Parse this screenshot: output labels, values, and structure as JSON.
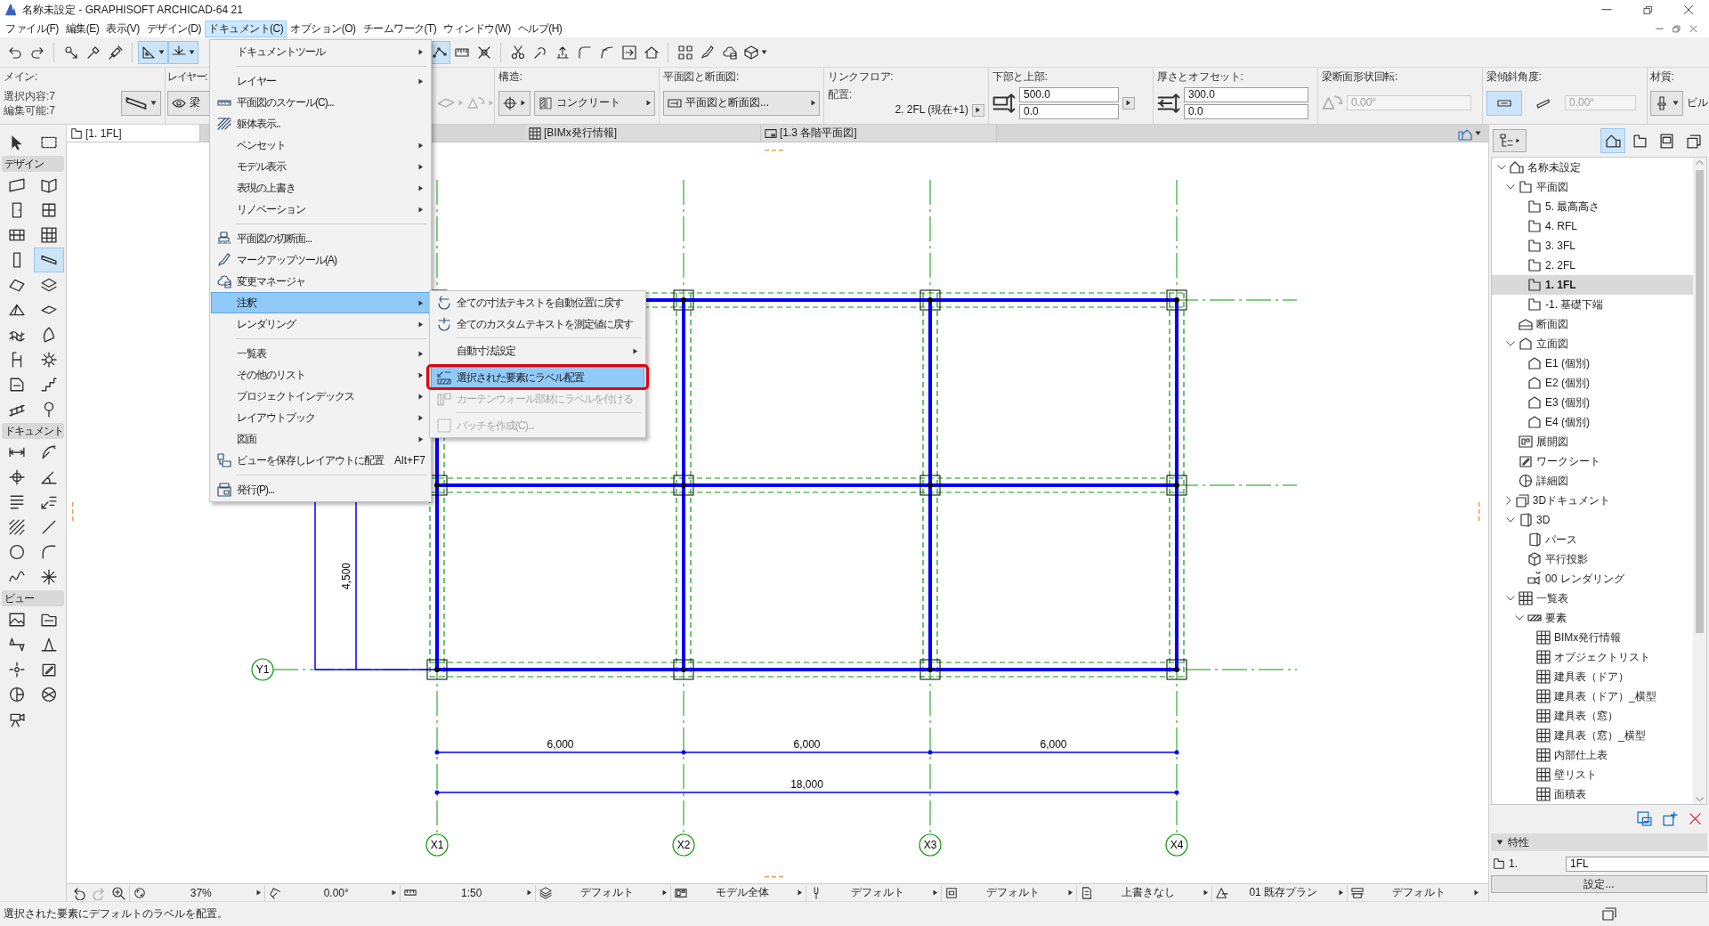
{
  "window": {
    "title": "名称未設定 - GRAPHISOFT ARCHICAD-64 21"
  },
  "menu_bar": [
    {
      "label": "ファイル(F)",
      "selected": false
    },
    {
      "label": "編集(E)",
      "selected": false
    },
    {
      "label": "表示(V)",
      "selected": false
    },
    {
      "label": "デザイン(D)",
      "selected": false
    },
    {
      "label": "ドキュメント(C)",
      "selected": true
    },
    {
      "label": "オプション(O)",
      "selected": false
    },
    {
      "label": "チームワーク(T)",
      "selected": false
    },
    {
      "label": "ウィンドウ(W)",
      "selected": false
    },
    {
      "label": "ヘルプ(H)",
      "selected": false
    }
  ],
  "toolbar": {
    "groups": [
      [
        {
          "selected": false
        },
        {
          "selected": false
        }
      ],
      [
        {
          "selected": false
        },
        {
          "selected": false
        },
        {
          "selected": false
        }
      ],
      [
        {
          "selected": true
        },
        {
          "selected": true
        }
      ],
      [
        {
          "selected": true
        },
        {
          "selected": false
        },
        {
          "selected": false
        }
      ],
      [
        {
          "selected": false
        },
        {
          "selected": false
        },
        {
          "selected": false
        },
        {
          "selected": false
        },
        {
          "selected": false
        },
        {
          "selected": false
        },
        {
          "selected": false
        }
      ],
      [
        {
          "selected": false
        },
        {
          "selected": false
        },
        {
          "selected": false
        },
        {
          "selected": false
        }
      ]
    ]
  },
  "info_box": {
    "main": {
      "label": "メイン:",
      "selection": "選択内容:7",
      "editable": "編集可能:7"
    },
    "layer": {
      "label": "レイヤー:",
      "value": "梁"
    },
    "structure": {
      "label": "構造:",
      "material": "コンクリート"
    },
    "plan_and_section": {
      "label": "平面図と断面図:",
      "value": "平面図と断面図..."
    },
    "link_floor": {
      "label": "リンクフロア:",
      "placement": "配置:",
      "value": "2. 2FL (現在+1)"
    },
    "bottom_top": {
      "label": "下部と上部:",
      "fields": [
        "500.0",
        "0.0"
      ]
    },
    "thickness_offset": {
      "label": "厚さとオフセット:",
      "fields": [
        "300.0",
        "0.0"
      ]
    },
    "profile_rotation": {
      "label": "梁断面形状回転:",
      "value": "0.00°",
      "disabled": true
    },
    "slant_angle": {
      "label": "梁傾斜角度:",
      "options": [
        {
          "selected": true
        },
        {
          "selected": false
        }
      ],
      "value": "0.00°",
      "disabled": true
    },
    "material": {
      "label": "材質:",
      "value": "ビル"
    }
  },
  "toolbox": {
    "top_tools": [
      {
        "selected": false
      },
      {
        "selected": false
      }
    ],
    "sections": [
      {
        "title": "デザイン",
        "tools": [
          {
            "selected": false
          },
          {
            "selected": false
          },
          {
            "selected": false
          },
          {
            "selected": false
          },
          {
            "selected": false
          },
          {
            "selected": false
          },
          {
            "selected": false
          },
          {
            "selected": true
          },
          {
            "selected": false
          },
          {
            "selected": false
          },
          {
            "selected": false
          },
          {
            "selected": false
          },
          {
            "selected": false
          },
          {
            "selected": false
          },
          {
            "selected": false
          },
          {
            "selected": false
          },
          {
            "selected": false
          },
          {
            "selected": false
          },
          {
            "selected": false
          },
          {
            "selected": false
          }
        ]
      },
      {
        "title": "ドキュメント",
        "tools": [
          {
            "selected": false
          },
          {
            "selected": false
          },
          {
            "selected": false
          },
          {
            "selected": false
          },
          {
            "selected": false
          },
          {
            "selected": false
          },
          {
            "selected": false
          },
          {
            "selected": false
          },
          {
            "selected": false
          },
          {
            "selected": false
          },
          {
            "selected": false
          },
          {
            "selected": false
          }
        ]
      },
      {
        "title": "ビュー",
        "tools": [
          {
            "selected": false
          },
          {
            "selected": false
          },
          {
            "selected": false
          },
          {
            "selected": false
          },
          {
            "selected": false
          },
          {
            "selected": false
          },
          {
            "selected": false
          },
          {
            "selected": false
          },
          {
            "selected": false
          }
        ]
      }
    ]
  },
  "view_tabs": [
    {
      "label": "[1. 1FL]",
      "selected": true
    },
    {
      "label": "[BIMx発行情報]",
      "selected": false
    },
    {
      "label": "[1.3 各階平面図]",
      "selected": false
    }
  ],
  "canvas": {
    "x_axes": [
      "X1",
      "X2",
      "X3",
      "X4"
    ],
    "y_axes": [
      "Y1"
    ],
    "span_dimensions": [
      "6,000",
      "6,000",
      "6,000"
    ],
    "total_dimension": "18,000",
    "vertical_dimension": "4,500"
  },
  "status_bar": {
    "cells": [
      "37%",
      "0.00°",
      "1:50",
      "デフォルト",
      "モデル全体",
      "デフォルト",
      "デフォルト",
      "上書きなし",
      "01 既存プラン",
      "デフォルト"
    ]
  },
  "navigator": {
    "tabs": [
      {
        "selected": true
      },
      {
        "selected": false
      },
      {
        "selected": false
      },
      {
        "selected": false
      }
    ],
    "tree": [
      {
        "label": "名称未設定",
        "kind": "project",
        "selected": false,
        "expanded": true,
        "children": [
          {
            "label": "平面図",
            "kind": "floors",
            "selected": false,
            "expanded": true,
            "children": [
              {
                "label": "5. 最高高さ",
                "kind": "story",
                "selected": false
              },
              {
                "label": "4. RFL",
                "kind": "story",
                "selected": false
              },
              {
                "label": "3. 3FL",
                "kind": "story",
                "selected": false
              },
              {
                "label": "2. 2FL",
                "kind": "story",
                "selected": false
              },
              {
                "label": "1. 1FL",
                "kind": "story",
                "selected": true
              },
              {
                "label": "-1. 基礎下端",
                "kind": "story",
                "selected": false
              }
            ]
          },
          {
            "label": "断面図",
            "kind": "section",
            "selected": false
          },
          {
            "label": "立面図",
            "kind": "elevation",
            "selected": false,
            "expanded": true,
            "children": [
              {
                "label": "E1 (個別)",
                "kind": "elevation",
                "selected": false
              },
              {
                "label": "E2 (個別)",
                "kind": "elevation",
                "selected": false
              },
              {
                "label": "E3 (個別)",
                "kind": "elevation",
                "selected": false
              },
              {
                "label": "E4 (個別)",
                "kind": "elevation",
                "selected": false
              }
            ]
          },
          {
            "label": "展開図",
            "kind": "interior",
            "selected": false
          },
          {
            "label": "ワークシート",
            "kind": "worksheet",
            "selected": false
          },
          {
            "label": "詳細図",
            "kind": "detail",
            "selected": false
          },
          {
            "label": "3Dドキュメント",
            "kind": "document3d",
            "selected": false,
            "expanded": false
          },
          {
            "label": "3D",
            "kind": "model3d",
            "selected": false,
            "expanded": true,
            "children": [
              {
                "label": "パース",
                "kind": "perspective",
                "selected": false
              },
              {
                "label": "平行投影",
                "kind": "axonometry",
                "selected": false
              },
              {
                "label": "00 レンダリング",
                "kind": "camera",
                "selected": false
              }
            ]
          },
          {
            "label": "一覧表",
            "kind": "schedule",
            "selected": false,
            "expanded": true,
            "children": [
              {
                "label": "要素",
                "kind": "elements",
                "selected": false,
                "expanded": true,
                "children": [
                  {
                    "label": "BIMx発行情報",
                    "kind": "schedule",
                    "selected": false
                  },
                  {
                    "label": "オブジェクトリスト",
                    "kind": "schedule",
                    "selected": false
                  },
                  {
                    "label": "建具表（ドア）",
                    "kind": "schedule",
                    "selected": false
                  },
                  {
                    "label": "建具表（ドア）_横型",
                    "kind": "schedule",
                    "selected": false
                  },
                  {
                    "label": "建具表（窓）",
                    "kind": "schedule",
                    "selected": false
                  },
                  {
                    "label": "建具表（窓）_横型",
                    "kind": "schedule",
                    "selected": false
                  },
                  {
                    "label": "内部仕上表",
                    "kind": "schedule",
                    "selected": false
                  },
                  {
                    "label": "壁リスト",
                    "kind": "schedule",
                    "selected": false
                  },
                  {
                    "label": "面積表",
                    "kind": "schedule",
                    "selected": false
                  }
                ]
              }
            ]
          }
        ]
      }
    ],
    "properties": {
      "title": "特性",
      "expanded": true,
      "story_index": "1.",
      "story_name": "1FL",
      "settings_button": "設定..."
    }
  },
  "message": "選択された要素にデフォルトのラベルを配置。",
  "document_menu": {
    "groups": [
      [
        {
          "label": "ドキュメントツール",
          "submenu": true,
          "selected": false
        }
      ],
      [
        {
          "label": "レイヤー",
          "submenu": true,
          "selected": false
        },
        {
          "label": "平面図のスケール(C)...",
          "submenu": false,
          "selected": false
        },
        {
          "label": "躯体表示..",
          "submenu": false,
          "selected": false
        },
        {
          "label": "ペンセット",
          "submenu": true,
          "selected": false
        },
        {
          "label": "モデル表示",
          "submenu": true,
          "selected": false
        },
        {
          "label": "表現の上書き",
          "submenu": true,
          "selected": false
        },
        {
          "label": "リノベーション",
          "submenu": true,
          "selected": false
        }
      ],
      [
        {
          "label": "平面図の切断面...",
          "submenu": false,
          "selected": false
        },
        {
          "label": "マークアップツール(A)",
          "submenu": false,
          "selected": false
        },
        {
          "label": "変更マネージャ",
          "submenu": false,
          "selected": false
        },
        {
          "label": "注釈",
          "submenu": true,
          "selected": true
        },
        {
          "label": "レンダリング",
          "submenu": true,
          "selected": false
        }
      ],
      [
        {
          "label": "一覧表",
          "submenu": true,
          "selected": false
        },
        {
          "label": "その他のリスト",
          "submenu": true,
          "selected": false
        },
        {
          "label": "プロジェクトインデックス",
          "submenu": true,
          "selected": false
        },
        {
          "label": "レイアウトブック",
          "submenu": true,
          "selected": false
        },
        {
          "label": "図面",
          "submenu": true,
          "selected": false
        },
        {
          "label": "ビューを保存しレイアウトに配置",
          "shortcut": "Alt+F7",
          "submenu": false,
          "selected": false
        }
      ],
      [
        {
          "label": "発行(P)...",
          "submenu": false,
          "selected": false
        }
      ]
    ]
  },
  "annotation_submenu": {
    "groups": [
      [
        {
          "label": "全ての寸法テキストを自動位置に戻す",
          "submenu": false,
          "selected": false,
          "disabled": false,
          "highlighted": false
        },
        {
          "label": "全てのカスタムテキストを測定値に戻す",
          "submenu": false,
          "selected": false,
          "disabled": false,
          "highlighted": false
        }
      ],
      [
        {
          "label": "自動寸法設定",
          "submenu": true,
          "selected": false,
          "disabled": false,
          "highlighted": false
        }
      ],
      [
        {
          "label": "選択された要素にラベル配置",
          "submenu": false,
          "selected": true,
          "disabled": false,
          "highlighted": true
        },
        {
          "label": "カーテンウォール部材にラベルを付ける",
          "submenu": false,
          "selected": false,
          "disabled": true,
          "highlighted": false
        }
      ],
      [
        {
          "label": "パッチを作成(C)...",
          "submenu": false,
          "selected": false,
          "disabled": true,
          "highlighted": false
        }
      ]
    ]
  }
}
